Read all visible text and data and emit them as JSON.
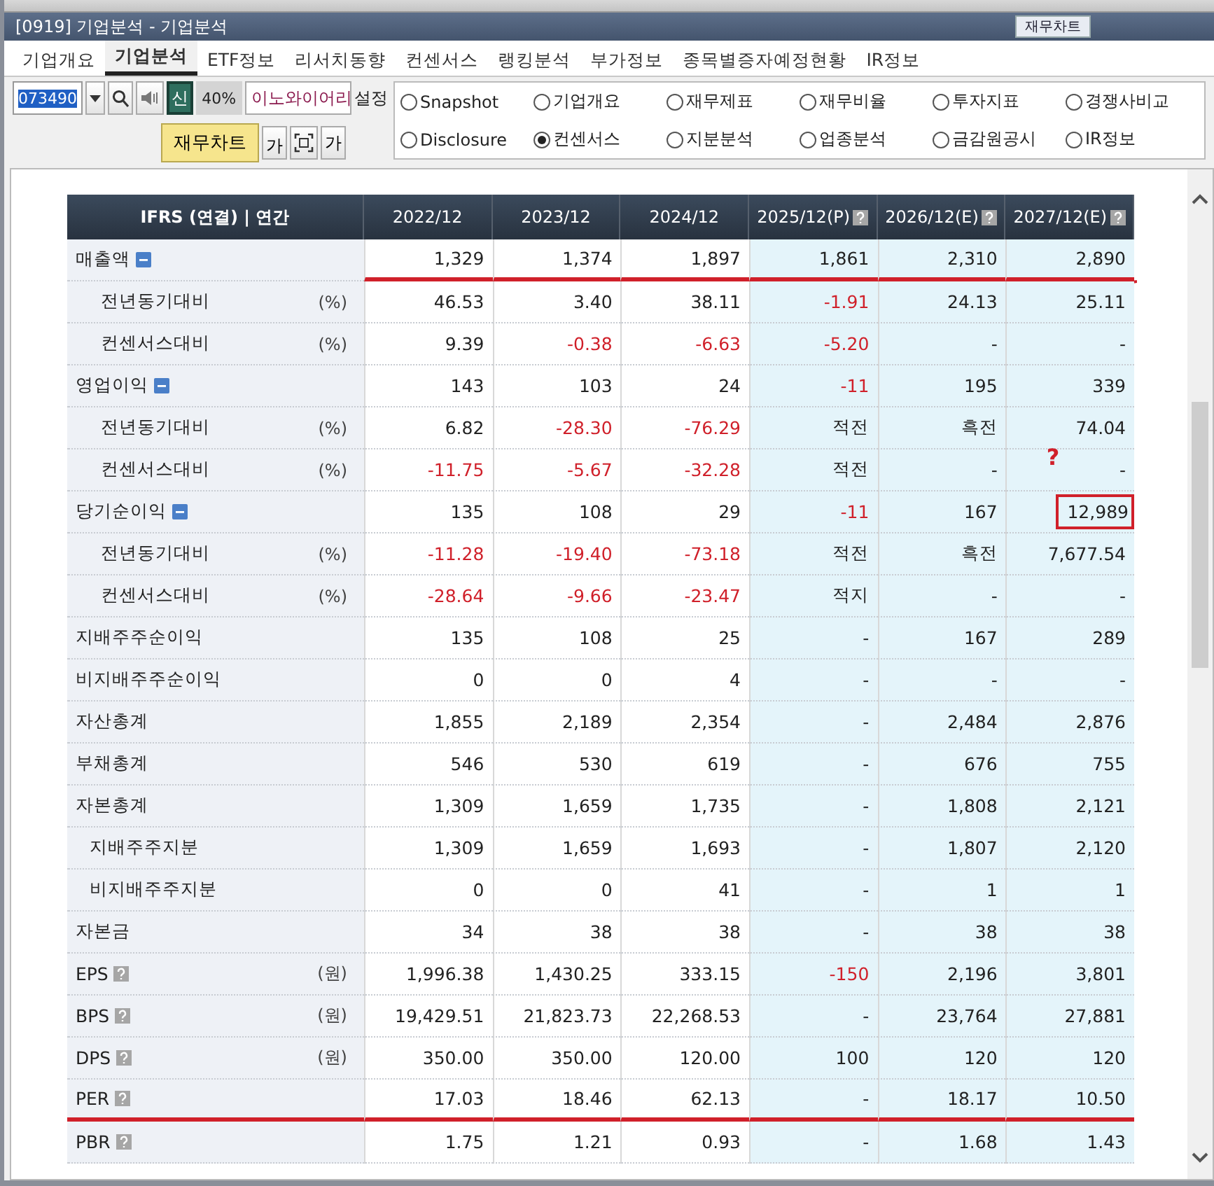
{
  "window": {
    "title": "[0919] 기업분석 - 기업분석",
    "title_button": "재무차트"
  },
  "tabs": [
    {
      "label": "기업개요",
      "selected": false
    },
    {
      "label": "기업분석",
      "selected": true
    },
    {
      "label": "ETF정보",
      "selected": false
    },
    {
      "label": "리서치동향",
      "selected": false
    },
    {
      "label": "컨센서스",
      "selected": false
    },
    {
      "label": "랭킹분석",
      "selected": false
    },
    {
      "label": "부가정보",
      "selected": false
    },
    {
      "label": "종목별증자예정현황",
      "selected": false
    },
    {
      "label": "IR정보",
      "selected": false
    }
  ],
  "controls": {
    "code": "073490",
    "badge": "신",
    "ratio": "40%",
    "company": "이노와이어리",
    "settings_label": "설정",
    "chart_button": "재무차트",
    "font_button": "가",
    "font_button_2": "가"
  },
  "views": [
    {
      "label": "Snapshot",
      "selected": false
    },
    {
      "label": "기업개요",
      "selected": false
    },
    {
      "label": "재무제표",
      "selected": false
    },
    {
      "label": "재무비율",
      "selected": false
    },
    {
      "label": "투자지표",
      "selected": false
    },
    {
      "label": "경쟁사비교",
      "selected": false
    },
    {
      "label": "Disclosure",
      "selected": false
    },
    {
      "label": "컨센서스",
      "selected": true
    },
    {
      "label": "지분분석",
      "selected": false
    },
    {
      "label": "업종분석",
      "selected": false
    },
    {
      "label": "금감원공시",
      "selected": false
    },
    {
      "label": "IR정보",
      "selected": false
    }
  ],
  "table": {
    "corner": "IFRS (연결) | 연간",
    "columns": [
      {
        "label": "2022/12",
        "estimate": false,
        "help": false
      },
      {
        "label": "2023/12",
        "estimate": false,
        "help": false
      },
      {
        "label": "2024/12",
        "estimate": false,
        "help": false
      },
      {
        "label": "2025/12(P)",
        "estimate": true,
        "help": true
      },
      {
        "label": "2026/12(E)",
        "estimate": true,
        "help": true
      },
      {
        "label": "2027/12(E)",
        "estimate": true,
        "help": true
      }
    ],
    "rows": [
      {
        "label": "매출액",
        "expanded": true,
        "underline_values": true,
        "cells": [
          "1,329",
          "1,374",
          "1,897",
          "1,861",
          "2,310",
          "2,890"
        ],
        "children": [
          {
            "label": "전년동기대비",
            "unit": "(%)",
            "cells": [
              "46.53",
              "3.40",
              "38.11",
              {
                "text": "-1.91",
                "negative": true
              },
              "24.13",
              "25.11"
            ]
          },
          {
            "label": "컨센서스대비",
            "unit": "(%)",
            "cells": [
              "9.39",
              {
                "text": "-0.38",
                "negative": true
              },
              {
                "text": "-6.63",
                "negative": true
              },
              {
                "text": "-5.20",
                "negative": true
              },
              "-",
              "-"
            ]
          }
        ]
      },
      {
        "label": "영업이익",
        "expanded": true,
        "cells": [
          "143",
          "103",
          "24",
          {
            "text": "-11",
            "negative": true
          },
          "195",
          "339"
        ],
        "children": [
          {
            "label": "전년동기대비",
            "unit": "(%)",
            "cells": [
              "6.82",
              {
                "text": "-28.30",
                "negative": true
              },
              {
                "text": "-76.29",
                "negative": true
              },
              "적전",
              "흑전",
              "74.04"
            ]
          },
          {
            "label": "컨센서스대비",
            "unit": "(%)",
            "cells": [
              {
                "text": "-11.75",
                "negative": true
              },
              {
                "text": "-5.67",
                "negative": true
              },
              {
                "text": "-32.28",
                "negative": true
              },
              "적전",
              "-",
              {
                "text": "-",
                "note": "?"
              }
            ]
          }
        ]
      },
      {
        "label": "당기순이익",
        "expanded": true,
        "cells": [
          "135",
          "108",
          "29",
          {
            "text": "-11",
            "negative": true
          },
          "167",
          {
            "text": "12,989",
            "boxed": true
          }
        ],
        "children": [
          {
            "label": "전년동기대비",
            "unit": "(%)",
            "cells": [
              {
                "text": "-11.28",
                "negative": true
              },
              {
                "text": "-19.40",
                "negative": true
              },
              {
                "text": "-73.18",
                "negative": true
              },
              "적전",
              "흑전",
              "7,677.54"
            ]
          },
          {
            "label": "컨센서스대비",
            "unit": "(%)",
            "cells": [
              {
                "text": "-28.64",
                "negative": true
              },
              {
                "text": "-9.66",
                "negative": true
              },
              {
                "text": "-23.47",
                "negative": true
              },
              "적지",
              "-",
              "-"
            ]
          }
        ]
      },
      {
        "label": "지배주주순이익",
        "cells": [
          "135",
          "108",
          "25",
          "-",
          "167",
          "289"
        ]
      },
      {
        "label": "비지배주주순이익",
        "cells": [
          "0",
          "0",
          "4",
          "-",
          "-",
          "-"
        ]
      },
      {
        "label": "자산총계",
        "cells": [
          "1,855",
          "2,189",
          "2,354",
          "-",
          "2,484",
          "2,876"
        ]
      },
      {
        "label": "부채총계",
        "cells": [
          "546",
          "530",
          "619",
          "-",
          "676",
          "755"
        ]
      },
      {
        "label": "자본총계",
        "cells": [
          "1,309",
          "1,659",
          "1,735",
          "-",
          "1,808",
          "2,121"
        ],
        "children": [
          {
            "label": "지배주주지분",
            "cells": [
              "1,309",
              "1,659",
              "1,693",
              "-",
              "1,807",
              "2,120"
            ]
          },
          {
            "label": "비지배주주지분",
            "cells": [
              "0",
              "0",
              "41",
              "-",
              "1",
              "1"
            ]
          }
        ]
      },
      {
        "label": "자본금",
        "cells": [
          "34",
          "38",
          "38",
          "-",
          "38",
          "38"
        ]
      },
      {
        "label": "EPS",
        "help": true,
        "unit": "(원)",
        "cells": [
          "1,996.38",
          "1,430.25",
          "333.15",
          {
            "text": "-150",
            "negative": true
          },
          "2,196",
          "3,801"
        ]
      },
      {
        "label": "BPS",
        "help": true,
        "unit": "(원)",
        "cells": [
          "19,429.51",
          "21,823.73",
          "22,268.53",
          "-",
          "23,764",
          "27,881"
        ]
      },
      {
        "label": "DPS",
        "help": true,
        "unit": "(원)",
        "cells": [
          "350.00",
          "350.00",
          "120.00",
          "100",
          "120",
          "120"
        ]
      },
      {
        "label": "PER",
        "help": true,
        "underline_full": true,
        "cells": [
          "17.03",
          "18.46",
          "62.13",
          "-",
          "18.17",
          "10.50"
        ]
      },
      {
        "label": "PBR",
        "help": true,
        "cells": [
          "1.75",
          "1.21",
          "0.93",
          "-",
          "1.68",
          "1.43"
        ]
      }
    ]
  }
}
